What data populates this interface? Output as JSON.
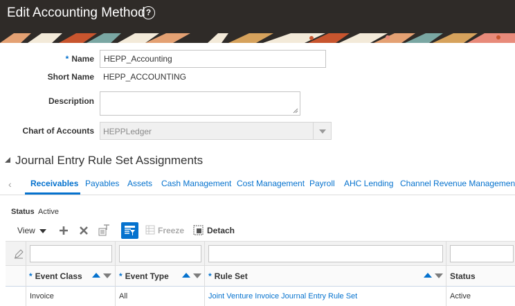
{
  "header": {
    "title": "Edit Accounting Method"
  },
  "form": {
    "name_label": "Name",
    "name_value": "HEPP_Accounting",
    "short_name_label": "Short Name",
    "short_name_value": "HEPP_ACCOUNTING",
    "description_label": "Description",
    "description_value": "",
    "coa_label": "Chart of Accounts",
    "coa_value": "HEPPLedger",
    "required_marker": "*"
  },
  "section": {
    "title": "Journal Entry Rule Set Assignments"
  },
  "tabs": [
    {
      "label": "Receivables",
      "active": true
    },
    {
      "label": "Payables"
    },
    {
      "label": "Assets"
    },
    {
      "label": "Cash Management"
    },
    {
      "label": "Cost Management"
    },
    {
      "label": "Payroll"
    },
    {
      "label": "AHC Lending"
    },
    {
      "label": "Channel Revenue Management"
    }
  ],
  "status": {
    "label": "Status",
    "value": "Active"
  },
  "toolbar": {
    "view_label": "View",
    "freeze_label": "Freeze",
    "detach_label": "Detach"
  },
  "table": {
    "columns": [
      {
        "label": "Event Class",
        "required": true
      },
      {
        "label": "Event Type",
        "required": true
      },
      {
        "label": "Rule Set",
        "required": true
      },
      {
        "label": "Status",
        "required": false
      }
    ],
    "rows": [
      {
        "event_class": "Invoice",
        "event_type": "All",
        "rule_set": "Joint Venture Invoice Journal Entry Rule Set",
        "status": "Active"
      }
    ]
  },
  "colors": {
    "accent": "#0572ce",
    "header_bg": "#2f2b28"
  }
}
